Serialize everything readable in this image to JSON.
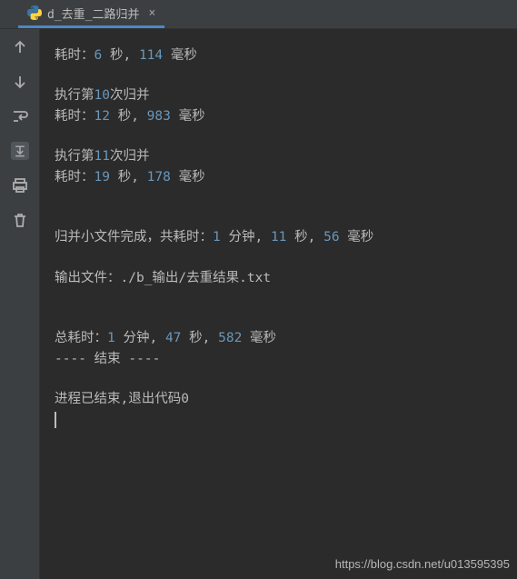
{
  "tab": {
    "filename": "d_去重_二路归并",
    "close_glyph": "×"
  },
  "console": {
    "l0_pre": "耗时：",
    "l0_v1": "6",
    "l0_mid1": " 秒, ",
    "l0_v2": "114",
    "l0_end": " 毫秒",
    "l1_pre": "执行第",
    "l1_v1": "10",
    "l1_end": "次归并",
    "l2_pre": "耗时：",
    "l2_v1": "12",
    "l2_mid1": " 秒, ",
    "l2_v2": "983",
    "l2_end": " 毫秒",
    "l3_pre": "执行第",
    "l3_v1": "11",
    "l3_end": "次归并",
    "l4_pre": "耗时：",
    "l4_v1": "19",
    "l4_mid1": " 秒, ",
    "l4_v2": "178",
    "l4_end": " 毫秒",
    "l5_pre": "归并小文件完成，共耗时：",
    "l5_v1": "1",
    "l5_mid1": " 分钟, ",
    "l5_v2": "11",
    "l5_mid2": " 秒, ",
    "l5_v3": "56",
    "l5_end": " 毫秒",
    "l6": "输出文件：./b_输出/去重结果.txt",
    "l7_pre": "总耗时：",
    "l7_v1": "1",
    "l7_mid1": " 分钟, ",
    "l7_v2": "47",
    "l7_mid2": " 秒, ",
    "l7_v3": "582",
    "l7_end": " 毫秒",
    "l8": "---- 结束 ----",
    "l9": "进程已结束,退出代码0"
  },
  "watermark": "https://blog.csdn.net/u013595395"
}
